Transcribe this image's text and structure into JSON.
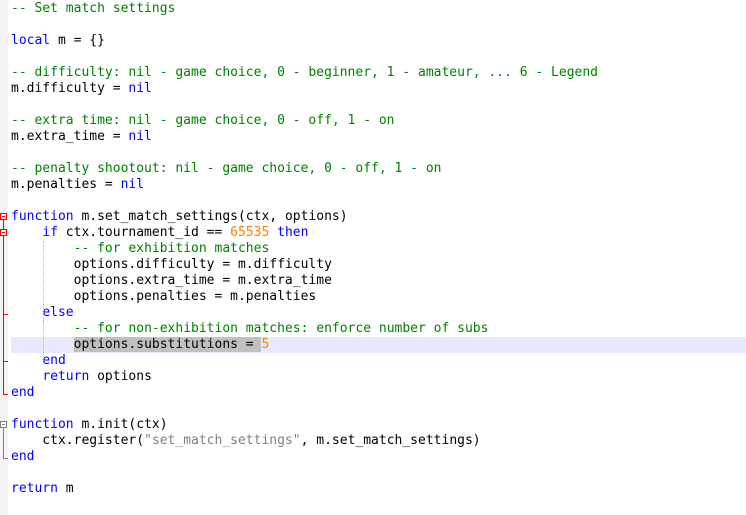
{
  "lines": [
    {
      "id": 1,
      "tokens": [
        {
          "t": "c",
          "v": "-- Set match settings"
        }
      ]
    },
    {
      "id": 2,
      "tokens": []
    },
    {
      "id": 3,
      "tokens": [
        {
          "t": "k",
          "v": "local"
        },
        {
          "t": "p",
          "v": " m = {}"
        }
      ]
    },
    {
      "id": 4,
      "tokens": []
    },
    {
      "id": 5,
      "tokens": [
        {
          "t": "c",
          "v": "-- difficulty: nil - game choice, 0 - beginner, 1 - amateur, ... 6 - Legend"
        }
      ]
    },
    {
      "id": 6,
      "tokens": [
        {
          "t": "p",
          "v": "m.difficulty = "
        },
        {
          "t": "k",
          "v": "nil"
        }
      ]
    },
    {
      "id": 7,
      "tokens": []
    },
    {
      "id": 8,
      "tokens": [
        {
          "t": "c",
          "v": "-- extra time: nil - game choice, 0 - off, 1 - on"
        }
      ]
    },
    {
      "id": 9,
      "tokens": [
        {
          "t": "p",
          "v": "m.extra_time = "
        },
        {
          "t": "k",
          "v": "nil"
        }
      ]
    },
    {
      "id": 10,
      "tokens": []
    },
    {
      "id": 11,
      "tokens": [
        {
          "t": "c",
          "v": "-- penalty shootout: nil - game choice, 0 - off, 1 - on"
        }
      ]
    },
    {
      "id": 12,
      "tokens": [
        {
          "t": "p",
          "v": "m.penalties = "
        },
        {
          "t": "k",
          "v": "nil"
        }
      ]
    },
    {
      "id": 13,
      "tokens": []
    },
    {
      "id": 14,
      "tokens": [
        {
          "t": "k",
          "v": "function"
        },
        {
          "t": "p",
          "v": " m.set_match_settings(ctx, options)"
        }
      ]
    },
    {
      "id": 15,
      "tokens": [
        {
          "t": "p",
          "v": "    "
        },
        {
          "t": "k",
          "v": "if"
        },
        {
          "t": "p",
          "v": " ctx.tournament_id == "
        },
        {
          "t": "n",
          "v": "65535"
        },
        {
          "t": "p",
          "v": " "
        },
        {
          "t": "k",
          "v": "then"
        }
      ]
    },
    {
      "id": 16,
      "tokens": [
        {
          "t": "p",
          "v": "        "
        },
        {
          "t": "c",
          "v": "-- for exhibition matches"
        }
      ]
    },
    {
      "id": 17,
      "tokens": [
        {
          "t": "p",
          "v": "        options.difficulty = m.difficulty"
        }
      ]
    },
    {
      "id": 18,
      "tokens": [
        {
          "t": "p",
          "v": "        options.extra_time = m.extra_time"
        }
      ]
    },
    {
      "id": 19,
      "tokens": [
        {
          "t": "p",
          "v": "        options.penalties = m.penalties"
        }
      ]
    },
    {
      "id": 20,
      "tokens": [
        {
          "t": "p",
          "v": "    "
        },
        {
          "t": "k",
          "v": "else"
        }
      ]
    },
    {
      "id": 21,
      "tokens": [
        {
          "t": "p",
          "v": "        "
        },
        {
          "t": "c",
          "v": "-- for non-exhibition matches: enforce number of subs"
        }
      ]
    },
    {
      "id": 22,
      "current": true,
      "tokens": [
        {
          "t": "p",
          "v": "        "
        },
        {
          "t": "sel",
          "v": "options.substitutions = "
        },
        {
          "t": "n",
          "v": "5"
        }
      ]
    },
    {
      "id": 23,
      "tokens": [
        {
          "t": "p",
          "v": "    "
        },
        {
          "t": "k",
          "v": "end"
        }
      ]
    },
    {
      "id": 24,
      "tokens": [
        {
          "t": "p",
          "v": "    "
        },
        {
          "t": "k",
          "v": "return"
        },
        {
          "t": "p",
          "v": " options"
        }
      ]
    },
    {
      "id": 25,
      "tokens": [
        {
          "t": "k",
          "v": "end"
        }
      ]
    },
    {
      "id": 26,
      "tokens": []
    },
    {
      "id": 27,
      "tokens": [
        {
          "t": "k",
          "v": "function"
        },
        {
          "t": "p",
          "v": " m.init(ctx)"
        }
      ]
    },
    {
      "id": 28,
      "tokens": [
        {
          "t": "p",
          "v": "    ctx.register("
        },
        {
          "t": "s",
          "v": "\"set_match_settings\""
        },
        {
          "t": "p",
          "v": ", m.set_match_settings)"
        }
      ]
    },
    {
      "id": 29,
      "tokens": [
        {
          "t": "k",
          "v": "end"
        }
      ]
    },
    {
      "id": 30,
      "tokens": []
    },
    {
      "id": 31,
      "tokens": [
        {
          "t": "k",
          "v": "return"
        },
        {
          "t": "p",
          "v": " m"
        }
      ]
    }
  ]
}
